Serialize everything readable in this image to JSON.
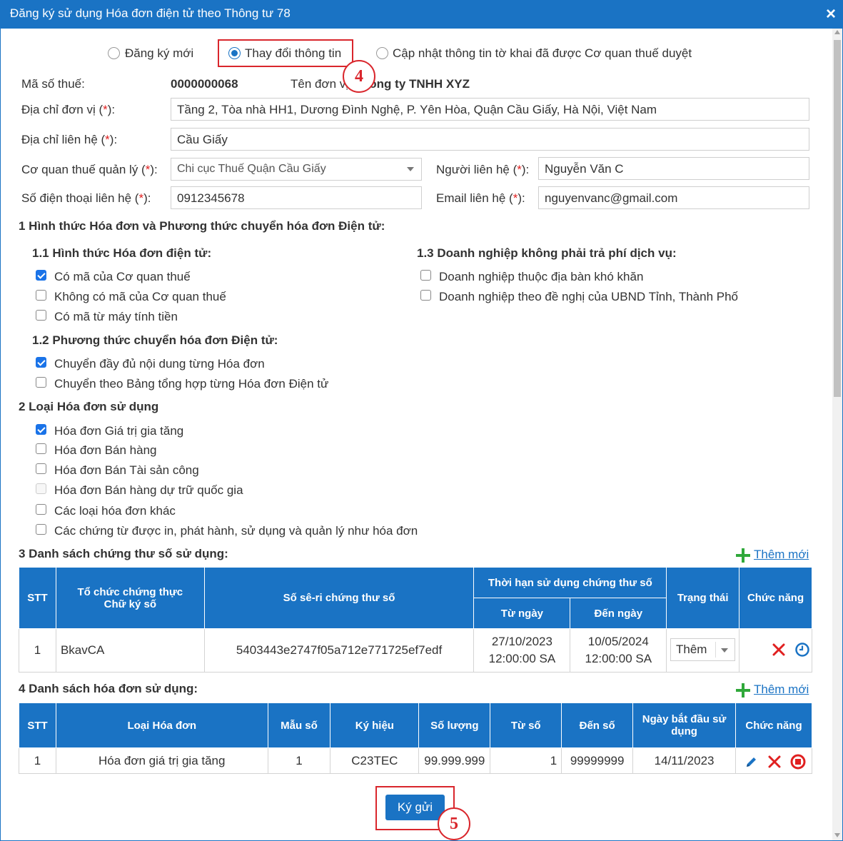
{
  "dialog": {
    "title": "Đăng ký sử dụng Hóa đơn điện tử theo Thông tư 78",
    "close": "×"
  },
  "mode_options": [
    {
      "label": "Đăng ký mới",
      "selected": false
    },
    {
      "label": "Thay đổi thông tin",
      "selected": true
    },
    {
      "label": "Cập nhật thông tin tờ khai đã được Cơ quan thuế duyệt",
      "selected": false
    }
  ],
  "callouts": {
    "step4": "4",
    "step5": "5"
  },
  "form": {
    "tax_code_label": "Mã số thuế:",
    "tax_code_value": "0000000068",
    "unit_name_label": "Tên đơn vị:",
    "unit_name_value": "Công ty TNHH XYZ",
    "unit_address_label": "Địa chỉ đơn vị (",
    "unit_address_value": "Tầng 2, Tòa nhà HH1, Dương Đình Nghệ, P. Yên Hòa, Quận Cầu Giấy, Hà Nội, Việt Nam",
    "contact_address_label": "Địa chỉ liên hệ (",
    "contact_address_value": "Cầu Giấy",
    "tax_office_label": "Cơ quan thuế quản lý (",
    "tax_office_value": "Chi cục Thuế Quận Cầu Giấy",
    "contact_person_label": "Người liên hệ (",
    "contact_person_value": "Nguyễn Văn C",
    "phone_label": "Số điện thoại liên hệ (",
    "phone_value": "0912345678",
    "email_label": "Email liên hệ (",
    "email_value": "nguyenvanc@gmail.com",
    "required_mark": "*",
    "label_suffix": "):"
  },
  "section1": {
    "title": "1 Hình thức Hóa đơn và Phương thức chuyển hóa đơn Điện tử:",
    "sub11": {
      "title": "1.1 Hình thức Hóa đơn điện tử:",
      "items": [
        {
          "label": "Có mã của Cơ quan thuế",
          "checked": true
        },
        {
          "label": "Không có mã của Cơ quan thuế",
          "checked": false
        },
        {
          "label": "Có mã từ máy tính tiền",
          "checked": false
        }
      ]
    },
    "sub12": {
      "title": "1.2 Phương thức chuyển hóa đơn Điện tử:",
      "items": [
        {
          "label": "Chuyển đầy đủ nội dung từng Hóa đơn",
          "checked": true
        },
        {
          "label": "Chuyển theo Bảng tổng hợp từng Hóa đơn Điện tử",
          "checked": false
        }
      ]
    },
    "sub13": {
      "title": "1.3 Doanh nghiệp không phải trả phí dịch vụ:",
      "items": [
        {
          "label": "Doanh nghiệp thuộc địa bàn khó khăn",
          "checked": false
        },
        {
          "label": "Doanh nghiệp theo đề nghị của UBND Tỉnh, Thành Phố",
          "checked": false
        }
      ]
    }
  },
  "section2": {
    "title": "2 Loại Hóa đơn sử dụng",
    "items": [
      {
        "label": "Hóa đơn Giá trị gia tăng",
        "checked": true
      },
      {
        "label": "Hóa đơn Bán hàng",
        "checked": false
      },
      {
        "label": "Hóa đơn Bán Tài sản công",
        "checked": false
      },
      {
        "label": "Hóa đơn Bán hàng dự trữ quốc gia",
        "checked": false,
        "disabled": true
      },
      {
        "label": "Các loại hóa đơn khác",
        "checked": false
      },
      {
        "label": "Các chứng từ được in, phát hành, sử dụng và quản lý như hóa đơn",
        "checked": false
      }
    ]
  },
  "section3": {
    "title": "3 Danh sách chứng thư số sử dụng:",
    "add_label": "Thêm mới",
    "headers": {
      "stt": "STT",
      "org": "Tổ chức chứng thực Chữ ký số",
      "serial": "Số sê-ri chứng thư số",
      "validity": "Thời hạn sử dụng chứng thư số",
      "from": "Từ ngày",
      "to": "Đến ngày",
      "status": "Trạng thái",
      "actions": "Chức năng"
    },
    "rows": [
      {
        "stt": "1",
        "org": "BkavCA",
        "serial": "5403443e2747f05a712e771725ef7edf",
        "from_date": "27/10/2023",
        "from_time": "12:00:00 SA",
        "to_date": "10/05/2024",
        "to_time": "12:00:00 SA",
        "status": "Thêm"
      }
    ]
  },
  "section4": {
    "title": "4 Danh sách hóa đơn sử dụng:",
    "add_label": "Thêm mới",
    "headers": {
      "stt": "STT",
      "type": "Loại Hóa đơn",
      "form": "Mẫu số",
      "symbol": "Ký hiệu",
      "qty": "Số lượng",
      "from_no": "Từ số",
      "to_no": "Đến số",
      "start": "Ngày bắt đầu sử dụng",
      "actions": "Chức năng"
    },
    "rows": [
      {
        "stt": "1",
        "type": "Hóa đơn giá trị gia tăng",
        "form": "1",
        "symbol": "C23TEC",
        "qty": "99.999.999",
        "from_no": "1",
        "to_no": "99999999",
        "start": "14/11/2023"
      }
    ]
  },
  "submit_label": "Ký gửi",
  "colors": {
    "header": "#1a73c4",
    "callout": "#d9262c",
    "add": "#2fa83a"
  }
}
